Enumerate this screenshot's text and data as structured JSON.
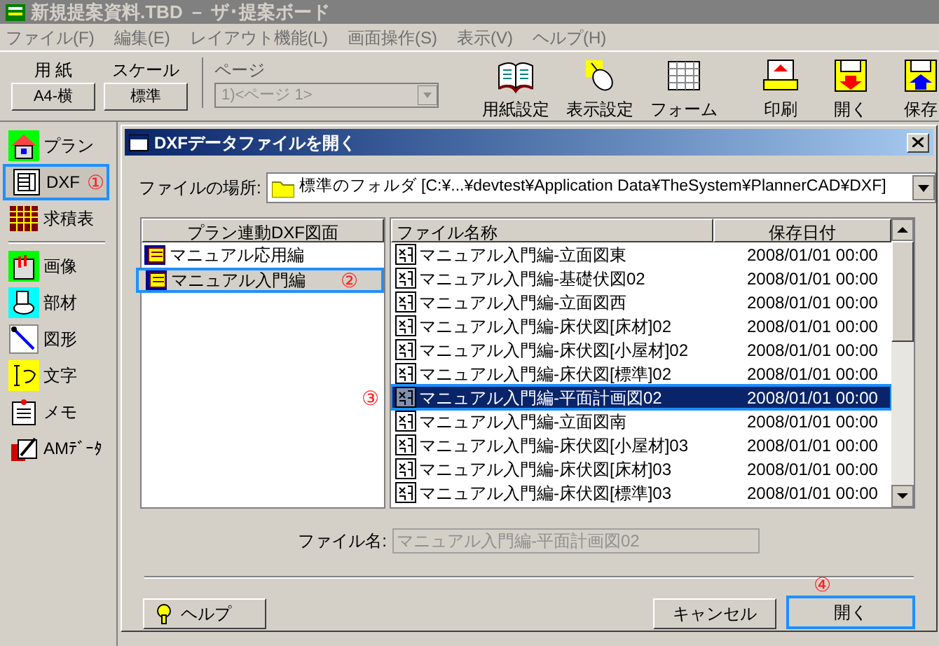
{
  "window": {
    "title": "新規提案資料.TBD － ザ･提案ボード"
  },
  "menu": [
    "ファイル(F)",
    "編集(E)",
    "レイアウト機能(L)",
    "画面操作(S)",
    "表示(V)",
    "ヘルプ(H)"
  ],
  "toolbar": {
    "paper": {
      "label": "用 紙",
      "value": "A4-横"
    },
    "scale": {
      "label": "スケール",
      "value": "標準"
    },
    "page": {
      "label": "ページ",
      "value": "1)<ページ 1>",
      "disabled": true
    },
    "buttons": [
      {
        "kind": "book",
        "label": "用紙設定"
      },
      {
        "kind": "mouse",
        "label": "表示設定"
      },
      {
        "kind": "grid",
        "label": "フォーム"
      },
      {
        "kind": "print",
        "label": "印刷"
      },
      {
        "kind": "open",
        "label": "開く"
      },
      {
        "kind": "save",
        "label": "保存"
      }
    ]
  },
  "sidebar": {
    "items": [
      {
        "kind": "house",
        "label": "プラン",
        "selected": false,
        "marker": ""
      },
      {
        "kind": "dxf",
        "label": "DXF",
        "selected": true,
        "marker": "①"
      },
      {
        "kind": "table",
        "label": "求積表",
        "selected": false,
        "marker": ""
      },
      {
        "kind": "image",
        "label": "画像",
        "selected": false,
        "marker": ""
      },
      {
        "kind": "part",
        "label": "部材",
        "selected": false,
        "marker": ""
      },
      {
        "kind": "shape",
        "label": "図形",
        "selected": false,
        "marker": ""
      },
      {
        "kind": "text",
        "label": "文字",
        "selected": false,
        "marker": ""
      },
      {
        "kind": "memo",
        "label": "メモ",
        "selected": false,
        "marker": ""
      },
      {
        "kind": "am",
        "label": "AMﾃﾞｰﾀ",
        "selected": false,
        "marker": ""
      }
    ]
  },
  "dialog": {
    "title": "DXFデータファイルを開く",
    "location_label": "ファイルの場所:",
    "location": "標準のフォルダ [C:¥...¥devtest¥Application Data¥TheSystem¥PlannerCAD¥DXF]",
    "plan_list": {
      "header": "プラン連動DXF図面",
      "items": [
        {
          "label": "マニュアル応用編",
          "selected": false,
          "marker": ""
        },
        {
          "label": "マニュアル入門編",
          "selected": true,
          "marker": "②"
        }
      ]
    },
    "file_list": {
      "columns": [
        "ファイル名称",
        "保存日付"
      ],
      "marker": "③",
      "rows": [
        {
          "name": "マニュアル入門編-立面図東",
          "date": "2008/01/01 00:00",
          "selected": false
        },
        {
          "name": "マニュアル入門編-基礎伏図02",
          "date": "2008/01/01 00:00",
          "selected": false
        },
        {
          "name": "マニュアル入門編-立面図西",
          "date": "2008/01/01 00:00",
          "selected": false
        },
        {
          "name": "マニュアル入門編-床伏図[床材]02",
          "date": "2008/01/01 00:00",
          "selected": false
        },
        {
          "name": "マニュアル入門編-床伏図[小屋材]02",
          "date": "2008/01/01 00:00",
          "selected": false
        },
        {
          "name": "マニュアル入門編-床伏図[標準]02",
          "date": "2008/01/01 00:00",
          "selected": false
        },
        {
          "name": "マニュアル入門編-平面計画図02",
          "date": "2008/01/01 00:00",
          "selected": true
        },
        {
          "name": "マニュアル入門編-立面図南",
          "date": "2008/01/01 00:00",
          "selected": false
        },
        {
          "name": "マニュアル入門編-床伏図[小屋材]03",
          "date": "2008/01/01 00:00",
          "selected": false
        },
        {
          "name": "マニュアル入門編-床伏図[床材]03",
          "date": "2008/01/01 00:00",
          "selected": false
        },
        {
          "name": "マニュアル入門編-床伏図[標準]03",
          "date": "2008/01/01 00:00",
          "selected": false
        }
      ]
    },
    "filename_label": "ファイル名:",
    "filename": "マニュアル入門編-平面計画図02",
    "help_button": "ヘルプ",
    "cancel_button": "キャンセル",
    "open_button": {
      "label": "開く",
      "marker": "④"
    }
  }
}
